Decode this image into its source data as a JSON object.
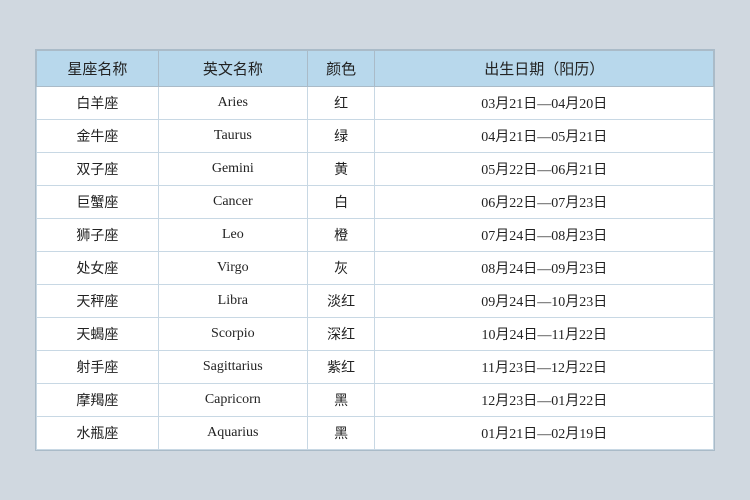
{
  "table": {
    "headers": {
      "chinese_name": "星座名称",
      "english_name": "英文名称",
      "color": "颜色",
      "birth_date": "出生日期（阳历）"
    },
    "rows": [
      {
        "chinese": "白羊座",
        "english": "Aries",
        "color": "红",
        "date": "03月21日—04月20日"
      },
      {
        "chinese": "金牛座",
        "english": "Taurus",
        "color": "绿",
        "date": "04月21日—05月21日"
      },
      {
        "chinese": "双子座",
        "english": "Gemini",
        "color": "黄",
        "date": "05月22日—06月21日"
      },
      {
        "chinese": "巨蟹座",
        "english": "Cancer",
        "color": "白",
        "date": "06月22日—07月23日"
      },
      {
        "chinese": "狮子座",
        "english": "Leo",
        "color": "橙",
        "date": "07月24日—08月23日"
      },
      {
        "chinese": "处女座",
        "english": "Virgo",
        "color": "灰",
        "date": "08月24日—09月23日"
      },
      {
        "chinese": "天秤座",
        "english": "Libra",
        "color": "淡红",
        "date": "09月24日—10月23日"
      },
      {
        "chinese": "天蝎座",
        "english": "Scorpio",
        "color": "深红",
        "date": "10月24日—11月22日"
      },
      {
        "chinese": "射手座",
        "english": "Sagittarius",
        "color": "紫红",
        "date": "11月23日—12月22日"
      },
      {
        "chinese": "摩羯座",
        "english": "Capricorn",
        "color": "黑",
        "date": "12月23日—01月22日"
      },
      {
        "chinese": "水瓶座",
        "english": "Aquarius",
        "color": "黑",
        "date": "01月21日—02月19日"
      }
    ]
  }
}
